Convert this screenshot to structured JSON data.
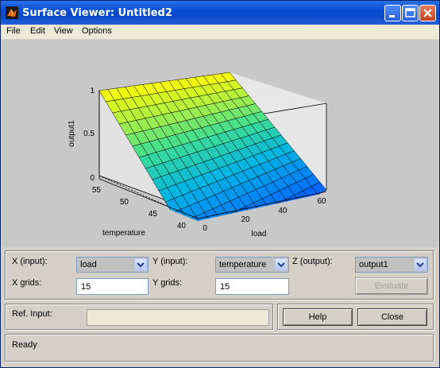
{
  "window": {
    "title": "Surface Viewer: Untitled2"
  },
  "menu": [
    "File",
    "Edit",
    "View",
    "Options"
  ],
  "plot": {
    "zlabel": "output1",
    "xlabel": "load",
    "ylabel": "temperature",
    "z_ticks": [
      "0",
      "0.5",
      "1"
    ],
    "x_ticks": [
      "0",
      "20",
      "40",
      "60"
    ],
    "y_ticks": [
      "40",
      "45",
      "50",
      "55"
    ]
  },
  "controls": {
    "x_input_label": "X (input):",
    "x_input_value": "load",
    "y_input_label": "Y (input):",
    "y_input_value": "temperature",
    "z_output_label": "Z (output):",
    "z_output_value": "output1",
    "x_grids_label": "X grids:",
    "x_grids_value": "15",
    "y_grids_label": "Y grids:",
    "y_grids_value": "15",
    "evaluate_label": "Evaluate"
  },
  "ref": {
    "label": "Ref. Input:",
    "value": ""
  },
  "buttons": {
    "help": "Help",
    "close": "Close"
  },
  "status": "Ready",
  "colors": {
    "titlebar": "#0a4ed6",
    "surface_high": "#ffff00",
    "surface_low": "#0060ff"
  }
}
